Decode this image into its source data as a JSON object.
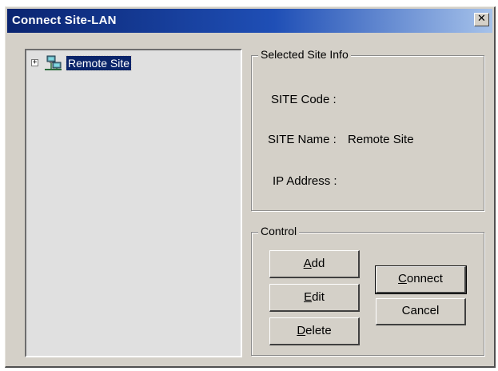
{
  "window": {
    "title": "Connect Site-LAN"
  },
  "tree": {
    "items": [
      {
        "label": "Remote Site",
        "expanded": false,
        "selected": true,
        "icon": "network-computers-icon"
      }
    ]
  },
  "site_info": {
    "legend": "Selected Site Info",
    "code_label": "SITE Code :",
    "code_value": "",
    "name_label": "SITE Name :",
    "name_value": "Remote Site",
    "ip_label": "IP Address :",
    "ip_value": ""
  },
  "control": {
    "legend": "Control",
    "add": {
      "prefix": "",
      "mnemonic": "A",
      "rest": "dd"
    },
    "edit": {
      "prefix": "",
      "mnemonic": "E",
      "rest": "dit"
    },
    "delete": {
      "prefix": "",
      "mnemonic": "D",
      "rest": "elete"
    },
    "connect": {
      "prefix": "",
      "mnemonic": "C",
      "rest": "onnect"
    },
    "cancel": "Cancel"
  },
  "colors": {
    "titlebar_start": "#0a2470",
    "selection": "#0a246a",
    "face": "#d4d0c8"
  }
}
